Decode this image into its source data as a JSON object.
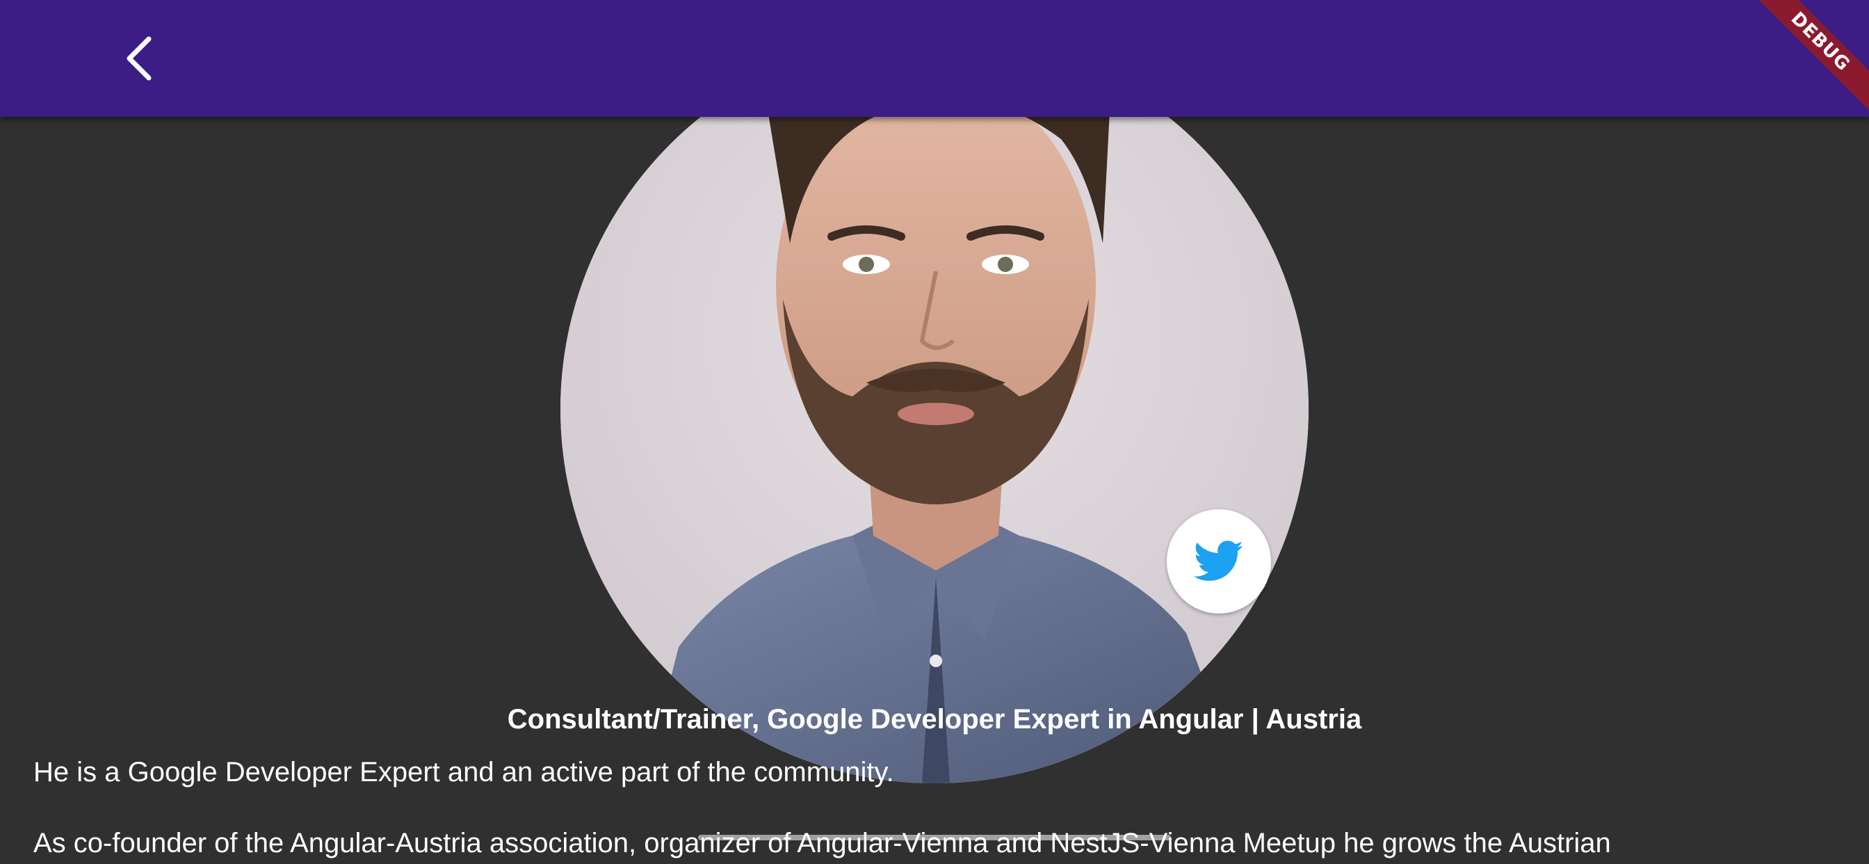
{
  "appbar": {
    "back_icon": "chevron-left-icon",
    "background_color": "#3c1d85"
  },
  "debug_banner": {
    "label": "DEBUG",
    "color": "#8b1a2e"
  },
  "speaker": {
    "avatar": "speaker-photo",
    "social_icon": "twitter-icon",
    "social_icon_color": "#1da1f2",
    "subtitle": "Consultant/Trainer, Google Developer Expert in Angular | Austria",
    "bio": [
      "He is a Google Developer Expert and an active part of the community.",
      "As co-founder of the Angular-Austria association, organizer of Angular-Vienna and NestJS-Vienna Meetup he grows the Austrian"
    ]
  },
  "colors": {
    "page_background": "#303030",
    "text": "#ffffff"
  }
}
